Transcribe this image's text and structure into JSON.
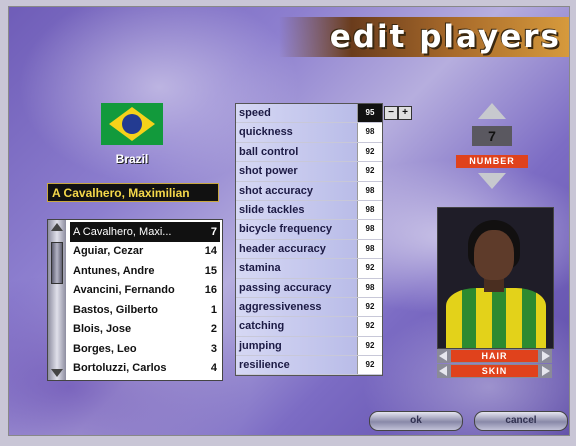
{
  "header": {
    "title": "edit players"
  },
  "team": {
    "country": "Brazil",
    "selected_player": "A Cavalhero, Maximilian"
  },
  "roster": [
    {
      "name": "A Cavalhero, Maxi...",
      "number": "7"
    },
    {
      "name": "Aguiar, Cezar",
      "number": "14"
    },
    {
      "name": "Antunes, Andre",
      "number": "15"
    },
    {
      "name": "Avancini, Fernando",
      "number": "16"
    },
    {
      "name": "Bastos, Gilberto",
      "number": "1"
    },
    {
      "name": "Blois, Jose",
      "number": "2"
    },
    {
      "name": "Borges, Leo",
      "number": "3"
    },
    {
      "name": "Bortoluzzi, Carlos",
      "number": "4"
    }
  ],
  "stats": [
    {
      "label": "speed",
      "value": "95"
    },
    {
      "label": "quickness",
      "value": "98"
    },
    {
      "label": "ball control",
      "value": "92"
    },
    {
      "label": "shot power",
      "value": "92"
    },
    {
      "label": "shot accuracy",
      "value": "98"
    },
    {
      "label": "slide tackles",
      "value": "98"
    },
    {
      "label": "bicycle frequency",
      "value": "98"
    },
    {
      "label": "header accuracy",
      "value": "98"
    },
    {
      "label": "stamina",
      "value": "92"
    },
    {
      "label": "passing accuracy",
      "value": "98"
    },
    {
      "label": "aggressiveness",
      "value": "92"
    },
    {
      "label": "catching",
      "value": "92"
    },
    {
      "label": "jumping",
      "value": "92"
    },
    {
      "label": "resilience",
      "value": "92"
    }
  ],
  "number": {
    "value": "7",
    "label": "NUMBER"
  },
  "appearance": {
    "hair_label": "HAIR",
    "skin_label": "SKIN"
  },
  "buttons": {
    "ok": "ok",
    "cancel": "cancel"
  },
  "colors": {
    "accent": "#e0421c",
    "flag_green": "#129a3c",
    "flag_yellow": "#f5d21a",
    "flag_blue": "#233b91",
    "name_text": "#f5d84a"
  }
}
